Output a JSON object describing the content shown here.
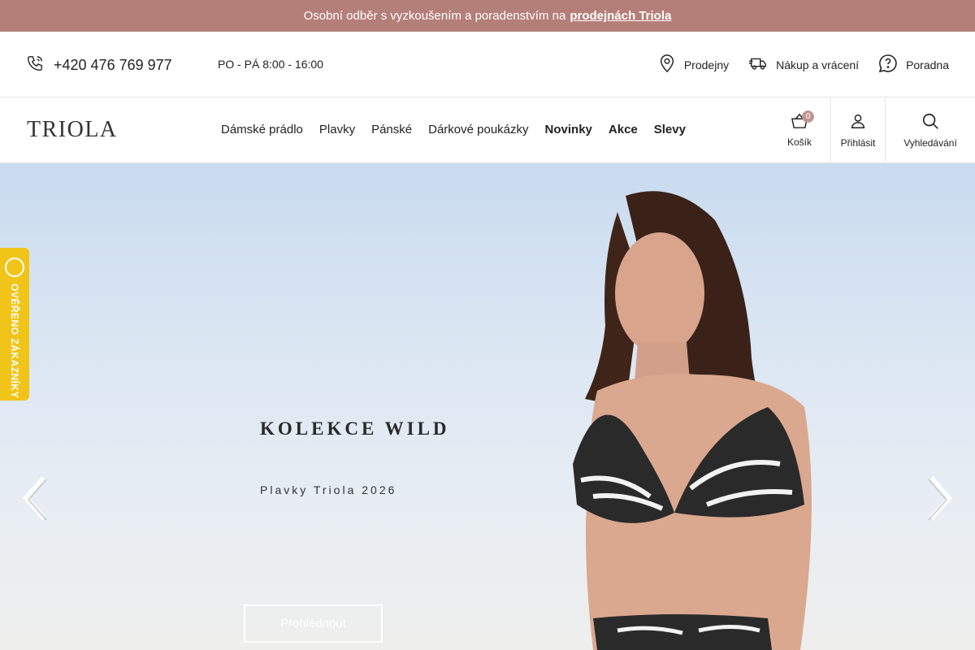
{
  "announcement": {
    "text": "Osobní odběr s vyzkoušením a poradenstvím na",
    "link": "prodejnách Triola"
  },
  "infobar": {
    "phone": "+420 476 769 977",
    "hours": "PO - PÁ 8:00 - 16:00",
    "links": [
      {
        "label": "Prodejny",
        "icon": "map-pin-icon"
      },
      {
        "label": "Nákup a vrácení",
        "icon": "delivery-truck-icon"
      },
      {
        "label": "Poradna",
        "icon": "question-bubble-icon"
      }
    ]
  },
  "nav": {
    "logo": "TRIOLA",
    "menu": [
      {
        "label": "Dámské prádlo"
      },
      {
        "label": "Plavky"
      },
      {
        "label": "Pánské"
      },
      {
        "label": "Dárkové poukázky"
      },
      {
        "label": "Novinky"
      },
      {
        "label": "Akce"
      },
      {
        "label": "Slevy"
      }
    ],
    "cart_label": "Košík",
    "cart_count": "0",
    "login_label": "Přihlásit",
    "search_label": "Vyhledávání"
  },
  "hero": {
    "title": "KOLEKCE WILD",
    "subtitle": "Plavky Triola 2026",
    "button": "Prohlédnout"
  },
  "verified_badge": {
    "text": "OVĚŘENO ZÁKAZNÍKY",
    "color": "#f0c419"
  },
  "colors": {
    "announce_bg": "#b57f79",
    "badge": "#c1968f"
  }
}
